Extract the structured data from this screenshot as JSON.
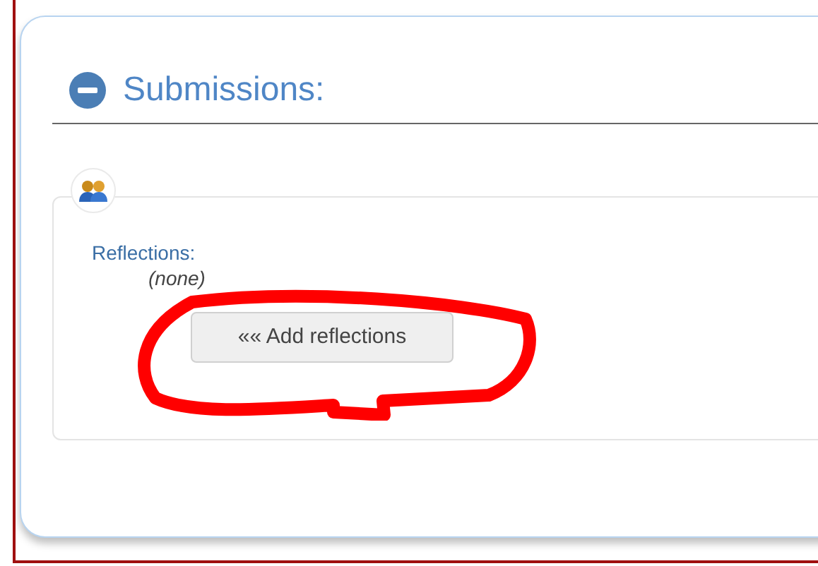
{
  "section": {
    "title": "Submissions:",
    "expanded": true
  },
  "reflections": {
    "label": "Reflections:",
    "value": "(none)",
    "button": "«« Add reflections"
  },
  "annotation": {
    "kind": "circle"
  }
}
